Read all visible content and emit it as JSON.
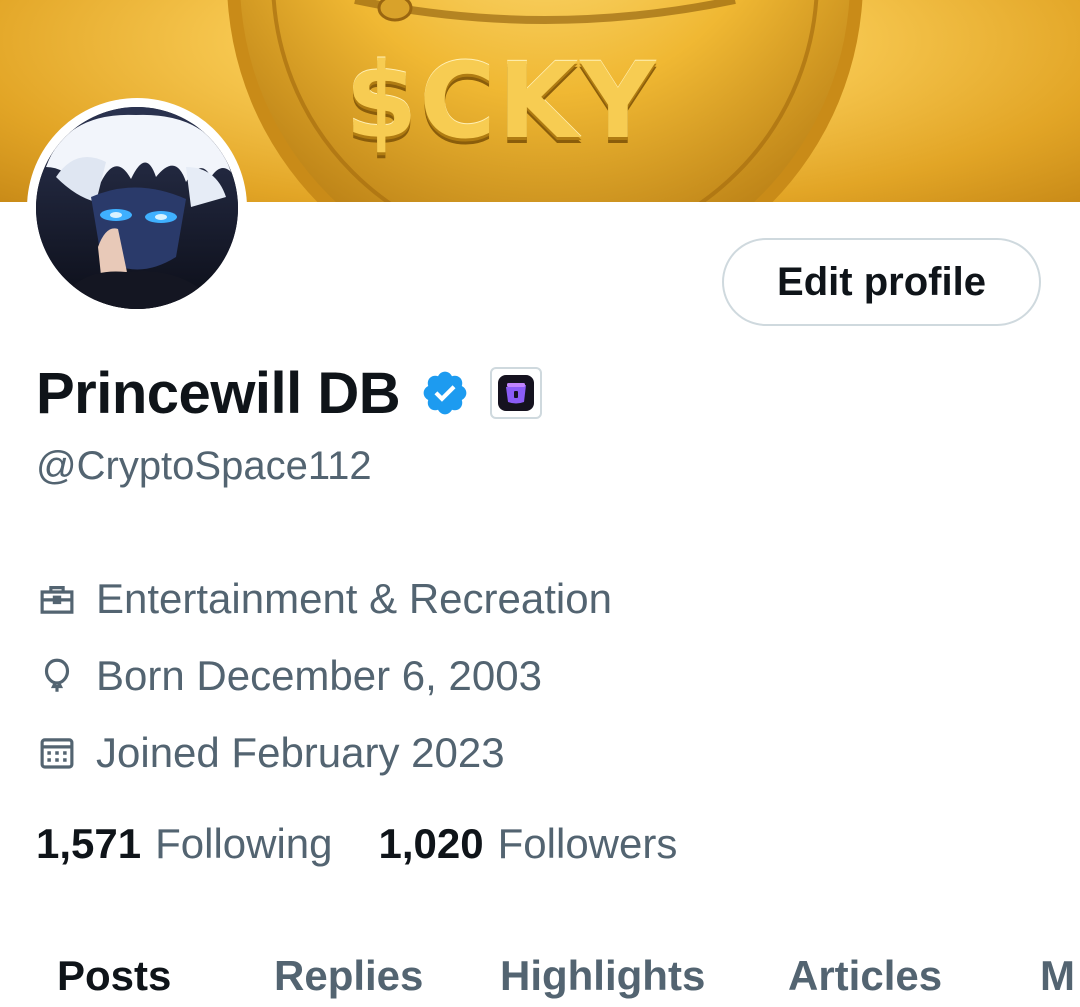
{
  "banner": {
    "coin_text": "$CKY"
  },
  "profile": {
    "display_name": "Princewill DB",
    "handle": "@CryptoSpace112",
    "edit_label": "Edit profile",
    "verified_icon": "verified-badge-icon",
    "affiliate_icon": "affiliate-badge-icon",
    "accent_color": "#1d9bf0"
  },
  "meta": {
    "category": "Entertainment & Recreation",
    "born": "Born December 6, 2003",
    "joined": "Joined February 2023"
  },
  "stats": {
    "following_count": "1,571",
    "following_label": "Following",
    "followers_count": "1,020",
    "followers_label": "Followers"
  },
  "tabs": [
    {
      "label": "Posts",
      "active": true
    },
    {
      "label": "Replies",
      "active": false
    },
    {
      "label": "Highlights",
      "active": false
    },
    {
      "label": "Articles",
      "active": false
    },
    {
      "label": "M",
      "active": false
    }
  ]
}
